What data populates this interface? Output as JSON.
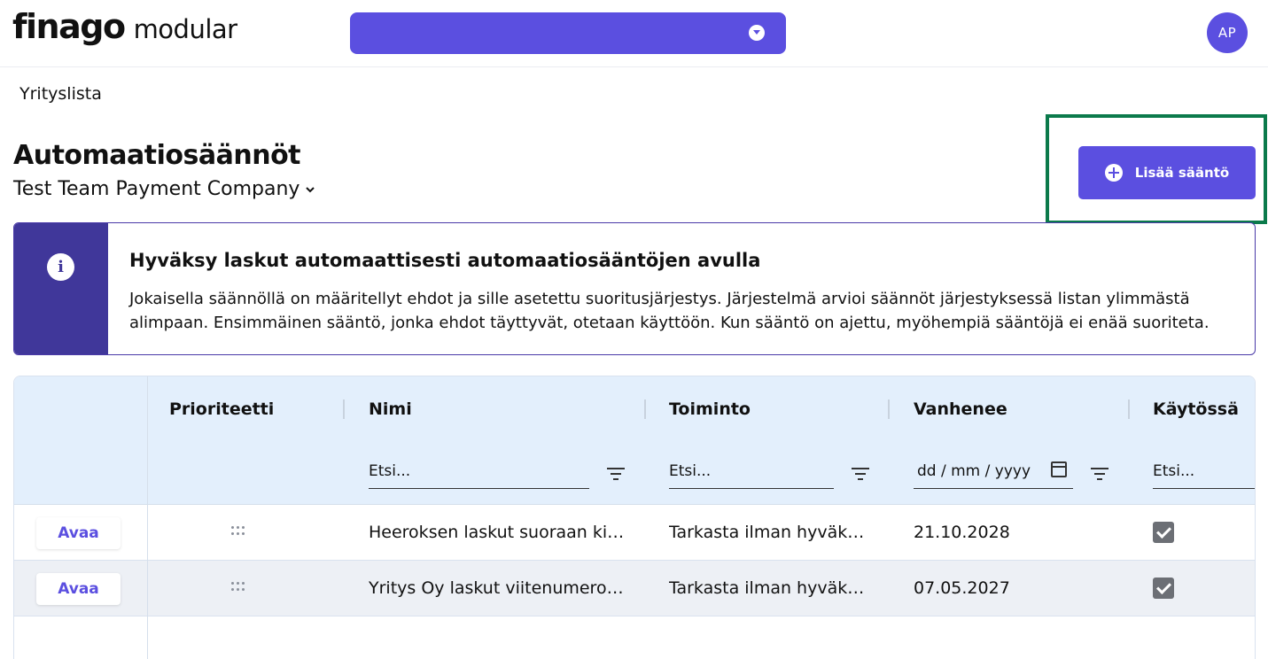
{
  "header": {
    "logo_brand": "finago",
    "logo_product": "modular",
    "avatar_initials": "AP"
  },
  "subnav": {
    "company_list_link": "Yrityslista"
  },
  "page": {
    "title": "Automaatiosäännöt",
    "company": "Test Team Payment Company",
    "add_rule_button": "Lisää sääntö"
  },
  "info": {
    "title": "Hyväksy laskut automaattisesti automaatiosääntöjen avulla",
    "text": "Jokaisella säännöllä on määritellyt ehdot ja sille asetettu suoritusjärjestys. Järjestelmä arvioi säännöt järjestyksessä listan ylimmästä alimpaan. Ensimmäinen sääntö, jonka ehdot täyttyvät, otetaan käyttöön. Kun sääntö on ajettu, myöhempiä sääntöjä ei enää suoriteta."
  },
  "table": {
    "columns": {
      "priority": "Prioriteetti",
      "name": "Nimi",
      "action": "Toiminto",
      "expires": "Vanhenee",
      "enabled": "Käytössä"
    },
    "filters": {
      "name_placeholder": "Etsi...",
      "action_placeholder": "Etsi...",
      "date_placeholder": "dd / mm / yyyy",
      "enabled_placeholder": "Etsi..."
    },
    "rows": [
      {
        "open_label": "Avaa",
        "name": "Heeroksen laskut suoraan kirjanpitoon",
        "action": "Tarkasta ilman hyväksyntää",
        "expires": "21.10.2028",
        "enabled": true
      },
      {
        "open_label": "Avaa",
        "name": "Yritys Oy laskut viitenumero perusteella",
        "action": "Tarkasta ilman hyväksyntää",
        "expires": "07.05.2027",
        "enabled": true
      }
    ]
  },
  "colors": {
    "accent": "#5b4fe0",
    "info_side": "#40379a",
    "highlight": "#0b7a4b",
    "table_header_bg": "#e3effc"
  }
}
